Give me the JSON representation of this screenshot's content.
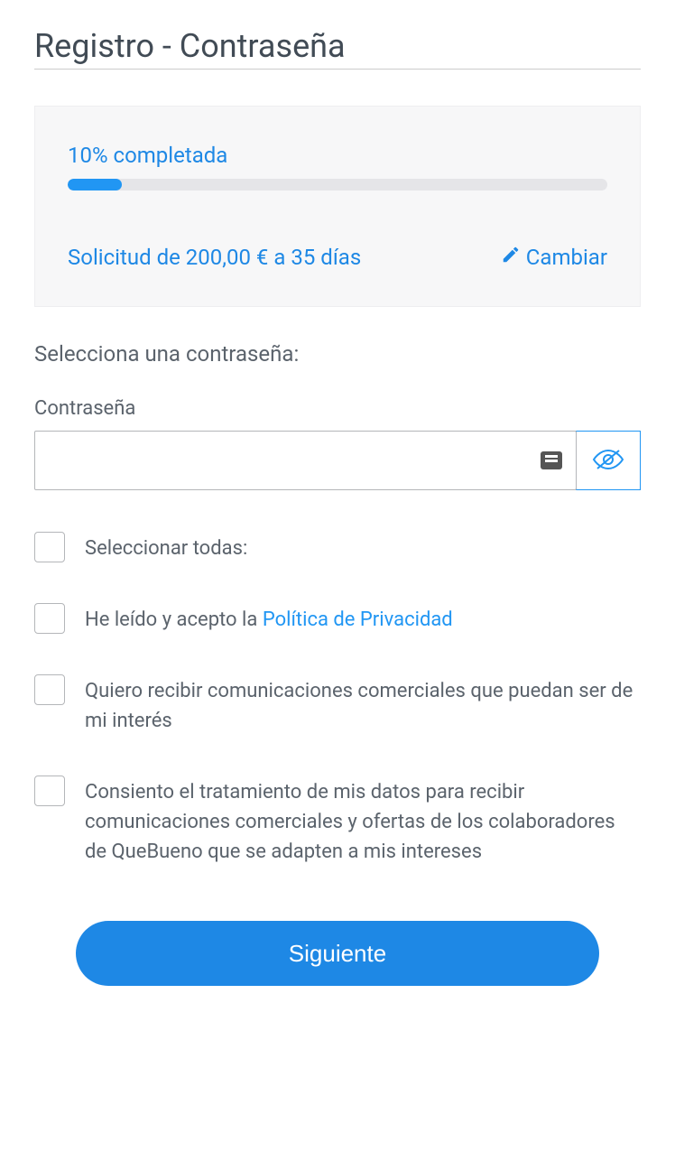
{
  "header": {
    "title": "Registro - Contraseña"
  },
  "progress": {
    "label": "10% completada",
    "percent": 10
  },
  "summary": {
    "description": "Solicitud de 200,00 € a 35 días",
    "change_label": "Cambiar"
  },
  "section": {
    "heading": "Selecciona una contraseña:"
  },
  "password": {
    "label": "Contraseña",
    "value": ""
  },
  "checkboxes": {
    "select_all": "Seleccionar todas:",
    "privacy_pre": "He leído y acepto la ",
    "privacy_link": "Política de Privacidad",
    "marketing": "Quiero recibir comunicaciones comerciales que puedan ser de mi interés",
    "partners": "Consiento el tratamiento de mis datos para recibir comunicaciones comerciales y ofertas de los colaboradores de QueBueno que se adapten a mis intereses"
  },
  "actions": {
    "next": "Siguiente"
  }
}
